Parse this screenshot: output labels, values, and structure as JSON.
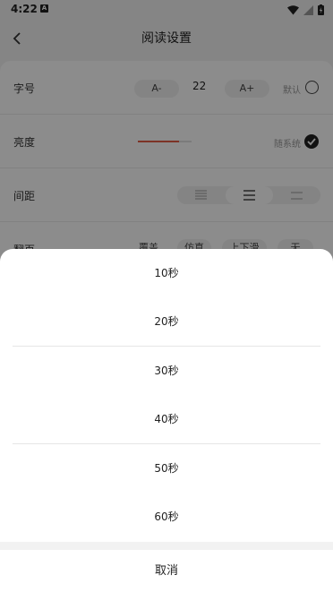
{
  "status_bar": {
    "time": "4:22",
    "a_icon": "A"
  },
  "header": {
    "title": "阅读设置"
  },
  "settings": {
    "font_size": {
      "label": "字号",
      "decrease": "A-",
      "value": "22",
      "increase": "A+",
      "default_label": "默认"
    },
    "brightness": {
      "label": "亮度",
      "follow_system": "随系统",
      "level": 0.77
    },
    "spacing": {
      "label": "间距"
    },
    "page_turn": {
      "label": "翻页",
      "options": [
        "覆盖",
        "仿真",
        "上下滑",
        "无"
      ]
    }
  },
  "sheet": {
    "options": [
      "10秒",
      "20秒",
      "30秒",
      "40秒",
      "50秒",
      "60秒"
    ],
    "cancel": "取消"
  },
  "colors": {
    "accent": "#e45d45",
    "overlay": "rgba(0,0,0,0.45)"
  }
}
